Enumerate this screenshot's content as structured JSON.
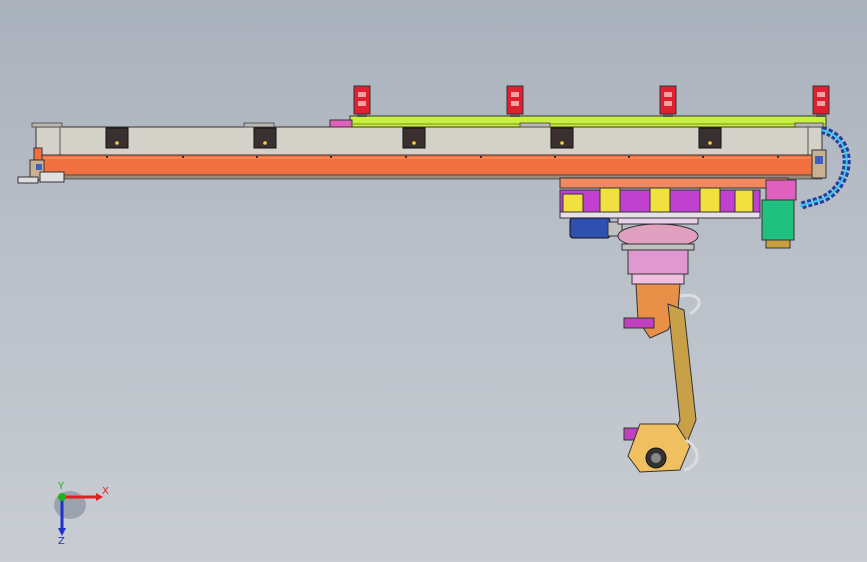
{
  "viewport": {
    "background_top": "#a9b1bc",
    "background_bottom": "#c9cdd3"
  },
  "triad": {
    "x_label": "X",
    "y_label": "Y",
    "z_label": "Z",
    "x_color": "#e02020",
    "y_color": "#20b020",
    "z_color": "#2030d0"
  },
  "colors": {
    "beam_orange": "#f07040",
    "beam_grey": "#d4d2c8",
    "rail_green": "#c8f040",
    "clamp_red": "#e02030",
    "carriage_purple": "#c040d0",
    "bracket_yellow": "#f0e040",
    "robot_gold": "#c8a048",
    "robot_pink": "#e098d0",
    "cable_chain": "#2040a0"
  }
}
